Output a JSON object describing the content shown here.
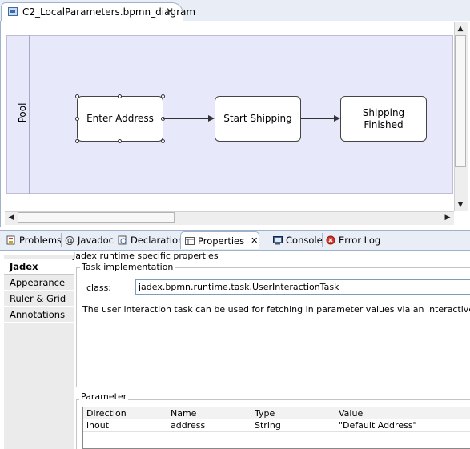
{
  "editor": {
    "tab_title": "C2_LocalParameters.bpmn_diagram",
    "close_glyph": "✕",
    "icon": "bpmn-diagram-icon"
  },
  "diagram": {
    "pool_label": "Pool",
    "tasks": [
      {
        "label": "Enter Address",
        "selected": true
      },
      {
        "label": "Start Shipping",
        "selected": false
      },
      {
        "label": "Shipping\nFinished",
        "selected": false
      }
    ],
    "canvas_color": "#e8e8fb"
  },
  "scrollbars": {
    "up": "▲",
    "down": "▼",
    "left": "◀",
    "right": "▶"
  },
  "views": {
    "tabs": [
      {
        "label": "Problems",
        "icon": "problems-icon",
        "active": false
      },
      {
        "label": "Javadoc",
        "icon": "javadoc-icon",
        "active": false
      },
      {
        "label": "Declaration",
        "icon": "declaration-icon",
        "active": false
      },
      {
        "label": "Properties",
        "icon": "properties-icon",
        "active": true
      },
      {
        "label": "Console",
        "icon": "console-icon",
        "active": false
      },
      {
        "label": "Error Log",
        "icon": "error-log-icon",
        "active": false
      }
    ],
    "javadoc_glyph": "@",
    "close_glyph": "✕"
  },
  "properties": {
    "sidebar_tabs": [
      {
        "label": "Jadex",
        "active": true
      },
      {
        "label": "Appearance",
        "active": false
      },
      {
        "label": "Ruler & Grid",
        "active": false
      },
      {
        "label": "Annotations",
        "active": false
      }
    ],
    "section_title": "Jadex runtime specific properties",
    "task_group": {
      "title": "Task implementation",
      "class_label": "class:",
      "class_value": "jadex.bpmn.runtime.task.UserInteractionTask",
      "description": "The user interaction task can be used for fetching in parameter values via an interactive user interfa"
    },
    "parameter_group": {
      "title": "Parameter",
      "columns": [
        "Direction",
        "Name",
        "Type",
        "Value"
      ],
      "rows": [
        [
          "inout",
          "address",
          "String",
          "\"Default Address\""
        ]
      ]
    }
  }
}
